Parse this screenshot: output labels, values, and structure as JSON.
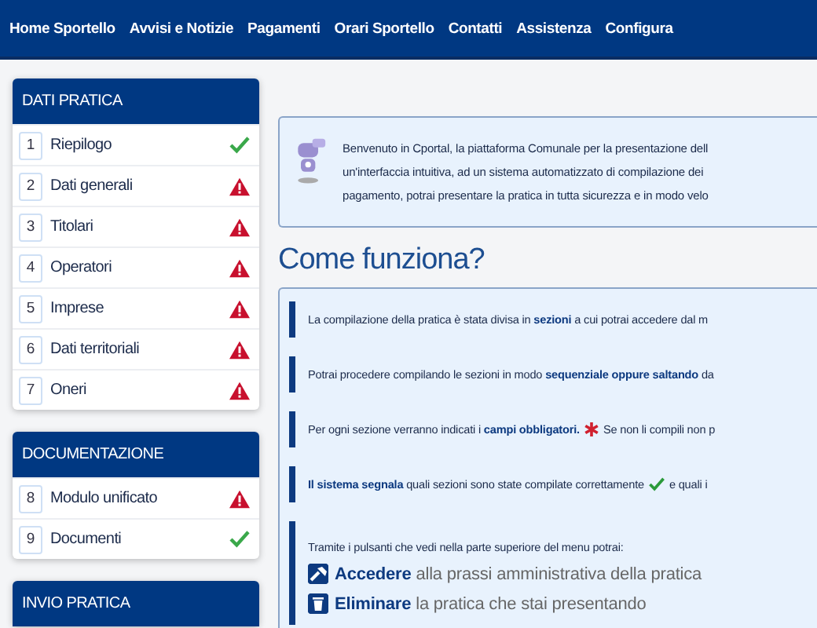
{
  "nav": {
    "items": [
      "Home Sportello",
      "Avvisi e Notizie",
      "Pagamenti",
      "Orari Sportello",
      "Contatti",
      "Assistenza",
      "Configura"
    ]
  },
  "sidebar": {
    "panels": [
      {
        "title": "DATI PRATICA",
        "items": [
          {
            "number": "1",
            "label": "Riepilogo",
            "complete": true
          },
          {
            "number": "2",
            "label": "Dati generali",
            "complete": false
          },
          {
            "number": "3",
            "label": "Titolari",
            "complete": false
          },
          {
            "number": "4",
            "label": "Operatori",
            "complete": false
          },
          {
            "number": "5",
            "label": "Imprese",
            "complete": false
          },
          {
            "number": "6",
            "label": "Dati territoriali",
            "complete": false
          },
          {
            "number": "7",
            "label": "Oneri",
            "complete": false
          }
        ]
      },
      {
        "title": "DOCUMENTAZIONE",
        "items": [
          {
            "number": "8",
            "label": "Modulo unificato",
            "complete": false
          },
          {
            "number": "9",
            "label": "Documenti",
            "complete": true
          }
        ]
      },
      {
        "title": "INVIO PRATICA"
      }
    ]
  },
  "welcome": {
    "lines": [
      "Benvenuto in Cportal, la piattaforma Comunale per la presentazione dell",
      "un'interfaccia intuitiva, ad un sistema automatizzato di compilazione dei",
      "pagamento, potrai presentare la pratica in tutta sicurezza e in modo velo"
    ]
  },
  "how_it_works": {
    "title": "Come funziona?",
    "steps": [
      {
        "kind": "text",
        "text": "La compilazione della pratica è stata divisa in **sezioni** a cui potrai accedere dal m"
      },
      {
        "kind": "text",
        "text": "Potrai procedere compilando le sezioni in modo **sequenziale oppure saltando** da"
      },
      {
        "kind": "required",
        "text": "Per ogni sezione verranno indicati i **campi obbligatori.**",
        "after": "Se non li compili non p"
      },
      {
        "kind": "check",
        "text": "**Il sistema segnala** quali sezioni sono state compilate correttamente",
        "after": "e quali i"
      },
      {
        "kind": "actions",
        "text": "Tramite i pulsanti che vedi nella parte superiore del menu potrai:",
        "actions": [
          {
            "name": "Accedere",
            "text": "alla prassi amministrativa della pratica"
          },
          {
            "name": "Eliminare",
            "text": "la pratica che stai presentando"
          }
        ]
      }
    ]
  }
}
